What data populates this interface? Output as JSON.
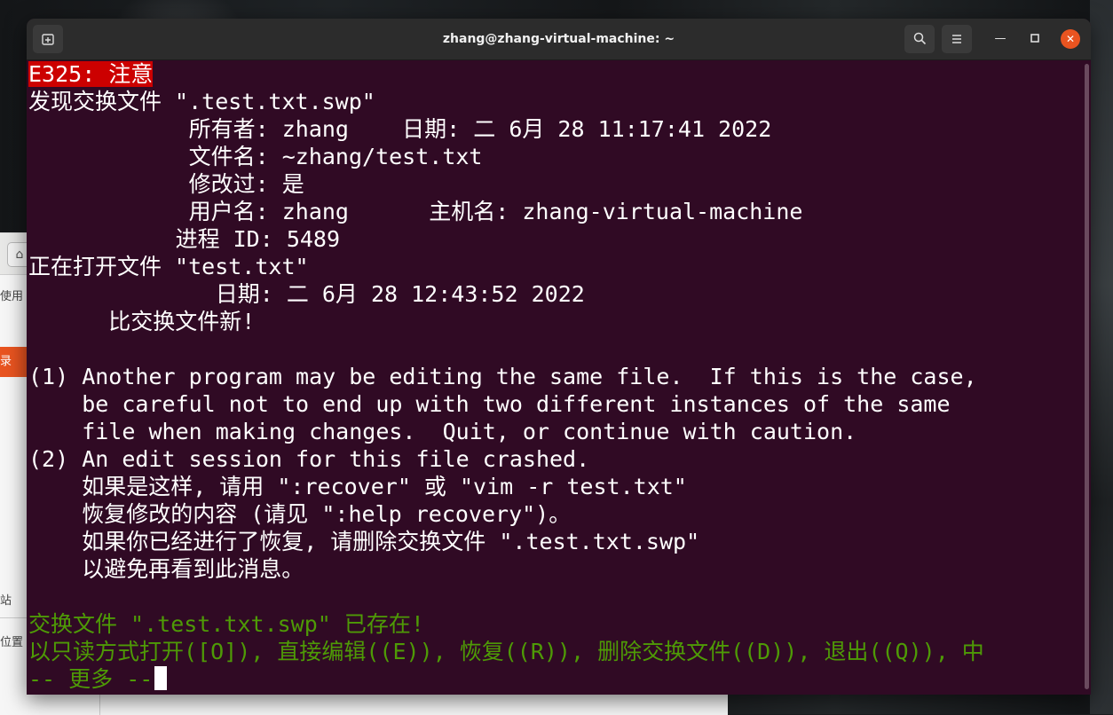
{
  "window": {
    "title": "zhang@zhang-virtual-machine: ~",
    "icons": {
      "new_tab": "new-tab-icon",
      "search": "search-icon",
      "menu": "hamburger-menu-icon",
      "minimize": "minimize-icon",
      "maximize": "maximize-icon",
      "close": "close-icon"
    }
  },
  "background_app": {
    "sidebar_items": [
      "使用",
      "录",
      "站",
      "位置"
    ]
  },
  "terminal": {
    "badge": "E325: 注意",
    "lines": [
      "发现交换文件 \".test.txt.swp\"",
      "            所有者: zhang    日期: 二 6月 28 11:17:41 2022",
      "            文件名: ~zhang/test.txt",
      "            修改过: 是",
      "            用户名: zhang      主机名: zhang-virtual-machine",
      "           进程 ID: 5489",
      "正在打开文件 \"test.txt\"",
      "              日期: 二 6月 28 12:43:52 2022",
      "      比交换文件新!",
      "",
      "(1) Another program may be editing the same file.  If this is the case,",
      "    be careful not to end up with two different instances of the same",
      "    file when making changes.  Quit, or continue with caution.",
      "(2) An edit session for this file crashed.",
      "    如果是这样, 请用 \":recover\" 或 \"vim -r test.txt\"",
      "    恢复修改的内容 (请见 \":help recovery\")。",
      "    如果你已经进行了恢复, 请删除交换文件 \".test.txt.swp\"",
      "    以避免再看到此消息。",
      ""
    ],
    "prompt_lines": [
      "交换文件 \".test.txt.swp\" 已存在!",
      "以只读方式打开([O]), 直接编辑((E)), 恢复((R)), 删除交换文件((D)), 退出((Q)), 中"
    ],
    "more_prompt": "-- 更多 --"
  },
  "colors": {
    "terminal_bg": "#300a24",
    "warning_bg": "#cc0000",
    "prompt_green": "#4e9a06",
    "close_button": "#e95420"
  }
}
